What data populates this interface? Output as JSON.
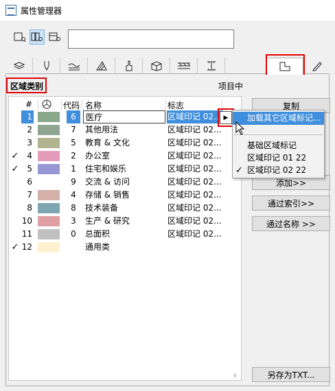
{
  "window": {
    "title": "属性管理器"
  },
  "search": {
    "value": ""
  },
  "header": {
    "section_label": "区域类别",
    "project_label": "项目中"
  },
  "table": {
    "columns": [
      "#",
      "代码",
      "名称",
      "标志"
    ],
    "rows": [
      {
        "check": "",
        "num": "1",
        "color": "#8aa88a",
        "code": "6",
        "name": "医疗",
        "mark": "区域印记 02...",
        "selected": true
      },
      {
        "check": "",
        "num": "2",
        "color": "#8fa592",
        "code": "7",
        "name": "其他用法",
        "mark": "区域印记 02..."
      },
      {
        "check": "",
        "num": "3",
        "color": "#b2b38f",
        "code": "5",
        "name": "教育 & 文化",
        "mark": "区域印记 02..."
      },
      {
        "check": "✓",
        "num": "4",
        "color": "#e49ab9",
        "code": "2",
        "name": "办公室",
        "mark": "区域印记 02..."
      },
      {
        "check": "✓",
        "num": "5",
        "color": "#9797d6",
        "code": "1",
        "name": "住宅和娱乐",
        "mark": "区域印记 02..."
      },
      {
        "check": "",
        "num": "6",
        "color": "",
        "code": "9",
        "name": "交流 & 访问",
        "mark": "区域印记 02..."
      },
      {
        "check": "",
        "num": "7",
        "color": "#d3b1a8",
        "code": "4",
        "name": "存储 & 销售",
        "mark": "区域印记 02..."
      },
      {
        "check": "",
        "num": "8",
        "color": "#7ea5b2",
        "code": "8",
        "name": "技术装备",
        "mark": "区域印记 02..."
      },
      {
        "check": "",
        "num": "10",
        "color": "#e0a0a3",
        "code": "3",
        "name": "生产 & 研究",
        "mark": "区域印记 02..."
      },
      {
        "check": "",
        "num": "11",
        "color": "#c0c0c0",
        "code": "0",
        "name": "总面积",
        "mark": "区域印记 02..."
      },
      {
        "check": "✓",
        "num": "12",
        "color": "#fdf1cf",
        "code": "",
        "name": "通用类",
        "mark": ""
      }
    ]
  },
  "buttons": {
    "copy": "复制",
    "add": "添加>>",
    "by_index": "通过索引>>",
    "by_name": "通过名称 >>",
    "save_txt": "另存为TXT..."
  },
  "dropdown": {
    "load_other": "加载其它区域标记...",
    "items": [
      {
        "label": "基础区域标记",
        "checked": false
      },
      {
        "label": "区域印记 01 22",
        "checked": false
      },
      {
        "label": "区域印记 02 22",
        "checked": true
      }
    ]
  },
  "icons": [
    "app-icon",
    "list-view-icon",
    "grid-view-icon",
    "detail-view-icon",
    "layers-icon",
    "pen-icon",
    "fill-icon",
    "surface-icon",
    "brush-icon",
    "building-material-icon",
    "profile-icon",
    "zone-category-icon",
    "pencil-icon",
    "color-wheel-icon",
    "triangle-right-icon",
    "checkmark-icon"
  ],
  "colors": {
    "selection": "#3f8fdd",
    "highlight_border": "#e00000"
  }
}
